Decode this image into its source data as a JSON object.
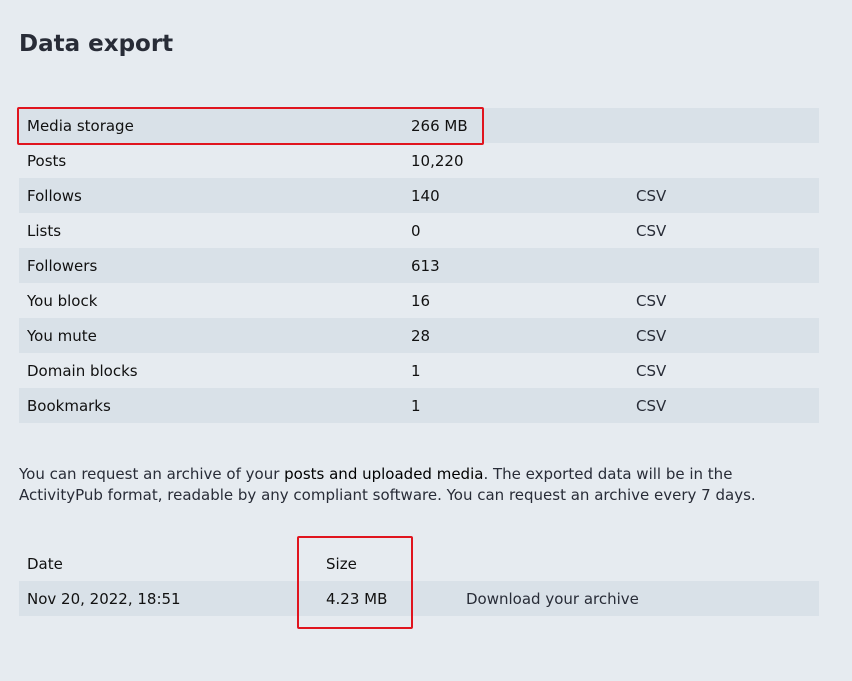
{
  "page": {
    "title": "Data export"
  },
  "stats": [
    {
      "label": "Media storage",
      "value": "266 MB",
      "action": ""
    },
    {
      "label": "Posts",
      "value": "10,220",
      "action": ""
    },
    {
      "label": "Follows",
      "value": "140",
      "action": "CSV"
    },
    {
      "label": "Lists",
      "value": "0",
      "action": "CSV"
    },
    {
      "label": "Followers",
      "value": "613",
      "action": ""
    },
    {
      "label": "You block",
      "value": "16",
      "action": "CSV"
    },
    {
      "label": "You mute",
      "value": "28",
      "action": "CSV"
    },
    {
      "label": "Domain blocks",
      "value": "1",
      "action": "CSV"
    },
    {
      "label": "Bookmarks",
      "value": "1",
      "action": "CSV"
    }
  ],
  "description": {
    "before": "You can request an archive of your ",
    "link": "posts and uploaded media",
    "after": ". The exported data will be in the ActivityPub format, readable by any compliant software. You can request an archive every 7 days."
  },
  "archive": {
    "headers": {
      "date": "Date",
      "size": "Size"
    },
    "rows": [
      {
        "date": "Nov 20, 2022, 18:51",
        "size": "4.23 MB",
        "action": "Download your archive"
      }
    ]
  },
  "colors": {
    "background": "#e6ebf0",
    "row_shade": "#d9e1e8",
    "highlight": "#e0141e"
  }
}
